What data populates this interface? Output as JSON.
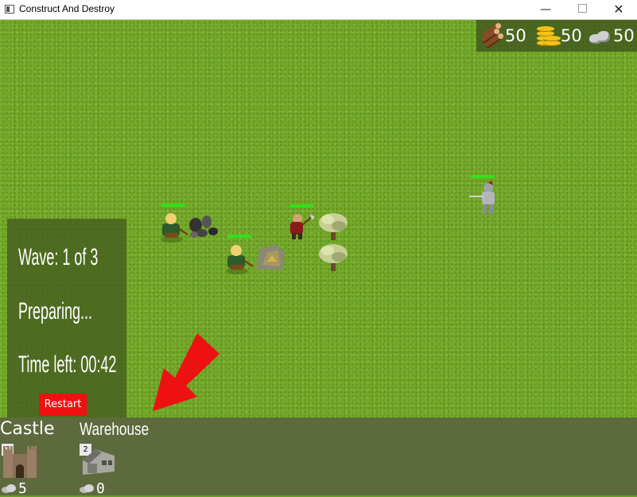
{
  "window": {
    "title": "Construct And Destroy",
    "min_glyph": "—",
    "close_glyph": "✕"
  },
  "resources": [
    {
      "name": "wood",
      "icon": "wood-logs-icon",
      "value": "50"
    },
    {
      "name": "gold",
      "icon": "gold-coins-icon",
      "value": "50"
    },
    {
      "name": "stone",
      "icon": "stone-icon",
      "value": "50"
    }
  ],
  "status": {
    "wave": "Wave: 1 of 3",
    "phase": "Preparing...",
    "time_left": "Time left: 00:42",
    "restart_label": "Restart"
  },
  "build_menu": [
    {
      "name": "Castle",
      "hotkey": "1",
      "cost_icon": "stone-icon",
      "cost": "5"
    },
    {
      "name": "Warehouse",
      "hotkey": "2",
      "cost_icon": "stone-icon",
      "cost": "0"
    }
  ],
  "colors": {
    "grass": "#73a82a",
    "health_bar": "#33e01a",
    "restart_button": "#f01010",
    "arrow": "#ee1111",
    "build_bar": "#5d6a3e"
  }
}
